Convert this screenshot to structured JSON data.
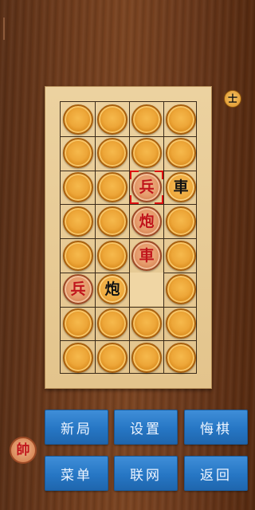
{
  "board": {
    "cols": 4,
    "rows": 8,
    "cells": [
      [
        {
          "t": "blank"
        },
        {
          "t": "blank"
        },
        {
          "t": "blank"
        },
        {
          "t": "blank"
        }
      ],
      [
        {
          "t": "blank"
        },
        {
          "t": "blank"
        },
        {
          "t": "blank"
        },
        {
          "t": "blank"
        }
      ],
      [
        {
          "t": "blank"
        },
        {
          "t": "blank"
        },
        {
          "t": "red",
          "label": "兵",
          "name": "red-soldier",
          "selected": true
        },
        {
          "t": "black",
          "label": "車",
          "name": "black-chariot"
        }
      ],
      [
        {
          "t": "blank"
        },
        {
          "t": "blank"
        },
        {
          "t": "red",
          "label": "炮",
          "name": "red-cannon"
        },
        {
          "t": "blank"
        }
      ],
      [
        {
          "t": "blank"
        },
        {
          "t": "blank"
        },
        {
          "t": "red",
          "label": "車",
          "name": "red-chariot"
        },
        {
          "t": "blank"
        }
      ],
      [
        {
          "t": "red",
          "label": "兵",
          "name": "red-soldier"
        },
        {
          "t": "black",
          "label": "炮",
          "name": "black-cannon"
        },
        {
          "t": "empty"
        },
        {
          "t": "blank"
        }
      ],
      [
        {
          "t": "blank"
        },
        {
          "t": "blank"
        },
        {
          "t": "blank"
        },
        {
          "t": "blank"
        }
      ],
      [
        {
          "t": "blank"
        },
        {
          "t": "blank"
        },
        {
          "t": "blank"
        },
        {
          "t": "blank"
        }
      ]
    ]
  },
  "captured": {
    "black_label": "士",
    "red_label": "帥"
  },
  "buttons": {
    "new_game": "新局",
    "settings": "设置",
    "undo": "悔棋",
    "menu": "菜单",
    "online": "联网",
    "back": "返回"
  },
  "colors": {
    "red_piece_text": "#c0141b",
    "black_piece_text": "#121212",
    "button_blue": "#2676c4",
    "selection": "#dd1111"
  }
}
